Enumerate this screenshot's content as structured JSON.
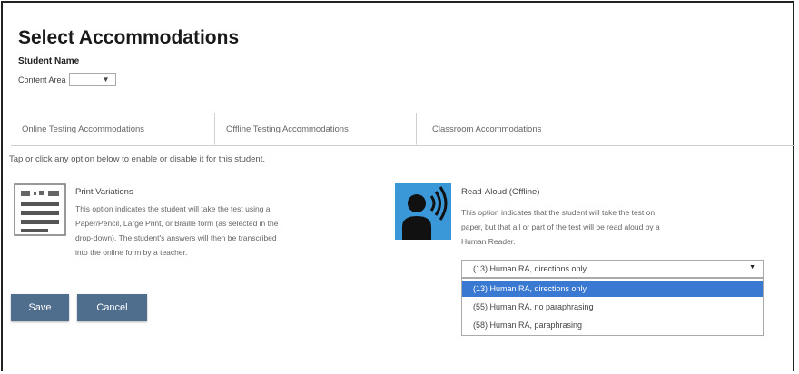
{
  "page": {
    "title": "Select Accommodations",
    "student_label": "Student Name",
    "content_area_label": "Content Area",
    "content_area_arrow": "▼"
  },
  "tabs": [
    {
      "label": "Online Testing Accommodations"
    },
    {
      "label": "Offline Testing Accommodations"
    },
    {
      "label": "Classroom Accommodations"
    }
  ],
  "hint": "Tap or click any option below to enable or disable it for this student.",
  "cards": {
    "print": {
      "title": "Print Variations",
      "desc_lines": [
        "This option indicates the student will take the test using a",
        "Paper/Pencil, Large Print, or Braille form (as selected in the",
        "drop-down). The student's answers will then be transcribed",
        "into the online form by a teacher."
      ]
    },
    "read_aloud": {
      "title": "Read-Aloud (Offline)",
      "desc_lines": [
        "This option indicates that the student will take the test on",
        "paper, but that all or part of the test will be read aloud by a",
        "Human Reader."
      ],
      "selected_value": "(13) Human RA, directions only",
      "arrow": "▼",
      "options": [
        {
          "label": "(13) Human RA, directions only"
        },
        {
          "label": "(55) Human RA, no paraphrasing"
        },
        {
          "label": "(58) Human RA, paraphrasing"
        }
      ]
    }
  },
  "buttons": {
    "save": "Save",
    "cancel": "Cancel"
  },
  "colors": {
    "button_bg": "#4f6e8e",
    "selected_option": "#3a79d2",
    "icon_bg": "#3b98d8"
  }
}
